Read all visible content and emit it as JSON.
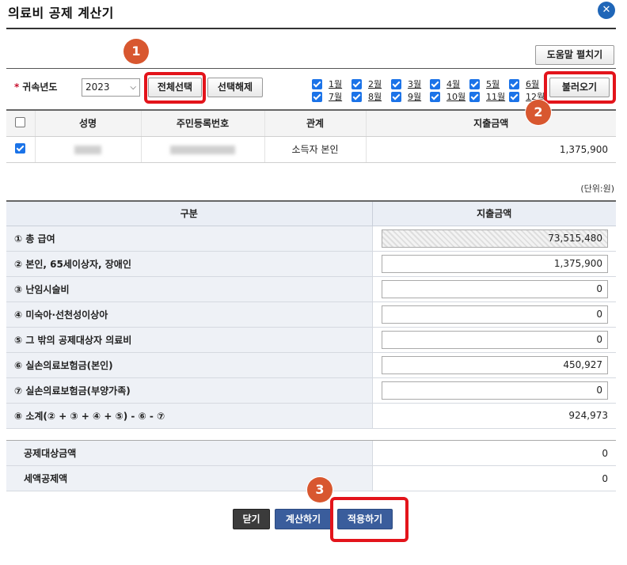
{
  "window": {
    "title": "의료비 공제 계산기",
    "close_icon": "close-icon",
    "accent": "#1f66b8"
  },
  "toolbar": {
    "help_label": "도움말 펼치기",
    "year_label": "귀속년도",
    "year_value": "2023",
    "select_all_label": "전체선택",
    "deselect_label": "선택해제",
    "load_label": "불러오기"
  },
  "months": [
    {
      "label": "1월",
      "checked": true
    },
    {
      "label": "2월",
      "checked": true
    },
    {
      "label": "3월",
      "checked": true
    },
    {
      "label": "4월",
      "checked": true
    },
    {
      "label": "5월",
      "checked": true
    },
    {
      "label": "6월",
      "checked": true
    },
    {
      "label": "7월",
      "checked": true
    },
    {
      "label": "8월",
      "checked": true
    },
    {
      "label": "9월",
      "checked": true
    },
    {
      "label": "10월",
      "checked": true
    },
    {
      "label": "11월",
      "checked": true
    },
    {
      "label": "12월",
      "checked": true
    }
  ],
  "person_table": {
    "headers": [
      "성명",
      "주민등록번호",
      "관계",
      "지출금액"
    ],
    "rows": [
      {
        "name": "",
        "id_number": "",
        "relation": "소득자 본인",
        "amount": "1,375,900",
        "checked": true
      }
    ]
  },
  "unit_label": "(단위:원)",
  "calc_table": {
    "headers": [
      "구분",
      "지출금액"
    ],
    "rows": [
      {
        "label": "① 총 급여",
        "value": "73,515,480"
      },
      {
        "label": "② 본인, 65세이상자, 장애인",
        "value": "1,375,900"
      },
      {
        "label": "③ 난임시술비",
        "value": "0"
      },
      {
        "label": "④ 미숙아·선천성이상아",
        "value": "0"
      },
      {
        "label": "⑤ 그 밖의 공제대상자 의료비",
        "value": "0"
      },
      {
        "label": "⑥ 실손의료보험금(본인)",
        "value": "450,927"
      },
      {
        "label": "⑦ 실손의료보험금(부양가족)",
        "value": "0"
      },
      {
        "label": "⑧ 소계(② + ③ + ④ + ⑤) - ⑥ - ⑦",
        "value": "924,973"
      }
    ]
  },
  "summary": [
    {
      "label": "공제대상금액",
      "value": "0"
    },
    {
      "label": "세액공제액",
      "value": "0"
    }
  ],
  "actions": {
    "close_label": "닫기",
    "calc_label": "계산하기",
    "apply_label": "적용하기"
  },
  "annotations": [
    {
      "number": "1"
    },
    {
      "number": "2"
    },
    {
      "number": "3"
    }
  ]
}
